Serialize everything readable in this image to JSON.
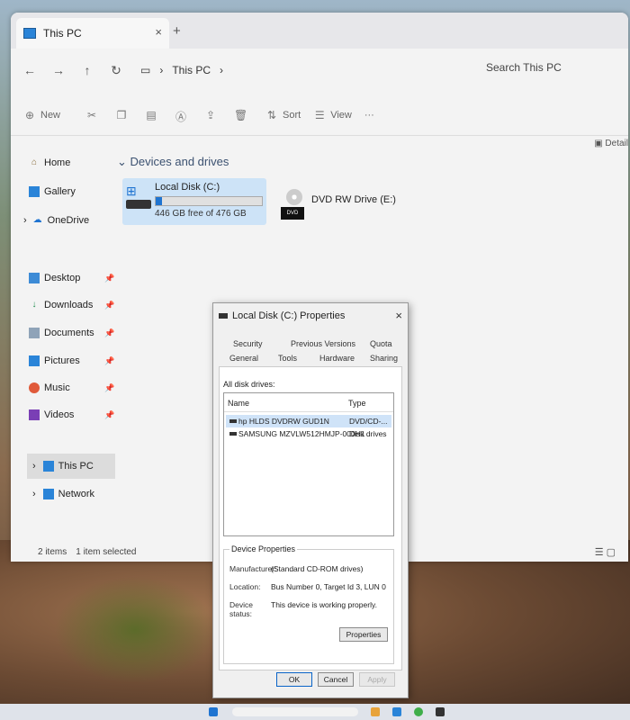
{
  "window": {
    "tab_title": "This PC",
    "tab_close": "×",
    "new_tab": "+"
  },
  "address": {
    "back": "←",
    "forward": "→",
    "up": "↑",
    "refresh": "↻",
    "location": "This PC",
    "chevron": "›",
    "search_placeholder": "Search This PC"
  },
  "toolbar": {
    "new_label": "New",
    "sort_label": "Sort",
    "view_label": "View",
    "more": "···",
    "details_label": "Detail"
  },
  "sidebar": {
    "home": "Home",
    "gallery": "Gallery",
    "onedrive": "OneDrive",
    "desktop": "Desktop",
    "downloads": "Downloads",
    "documents": "Documents",
    "pictures": "Pictures",
    "music": "Music",
    "videos": "Videos",
    "thispc": "This PC",
    "network": "Network"
  },
  "content": {
    "group_title": "Devices and drives",
    "drive_c": {
      "name": "Local Disk (C:)",
      "free_text": "446 GB free of 476 GB",
      "used_fraction": 0.063
    },
    "drive_e": {
      "name": "DVD RW Drive (E:)",
      "badge": "DVD"
    }
  },
  "statusbar": {
    "items": "2 items",
    "selected": "1 item selected"
  },
  "dialog": {
    "title": "Local Disk (C:) Properties",
    "close": "×",
    "tabs_top": [
      "Security",
      "Previous Versions",
      "Quota"
    ],
    "tabs_bottom": [
      "General",
      "Tools",
      "Hardware",
      "Sharing"
    ],
    "all_disk_label": "All disk drives:",
    "col_name": "Name",
    "col_type": "Type",
    "rows": [
      {
        "name": "hp HLDS DVDRW GUD1N",
        "type": "DVD/CD-..."
      },
      {
        "name": "SAMSUNG MZVLW512HMJP-000H1",
        "type": "Disk drives"
      }
    ],
    "device_props_title": "Device Properties",
    "manufacturer_label": "Manufacturer:",
    "manufacturer_value": "(Standard CD-ROM drives)",
    "location_label": "Location:",
    "location_value": "Bus Number 0, Target Id 3, LUN 0",
    "status_label": "Device status:",
    "status_value": "This device is working properly.",
    "properties_btn": "Properties",
    "ok_btn": "OK",
    "cancel_btn": "Cancel",
    "apply_btn": "Apply"
  },
  "colors": {
    "accent": "#1f74d1",
    "selection": "#cde3f7"
  }
}
